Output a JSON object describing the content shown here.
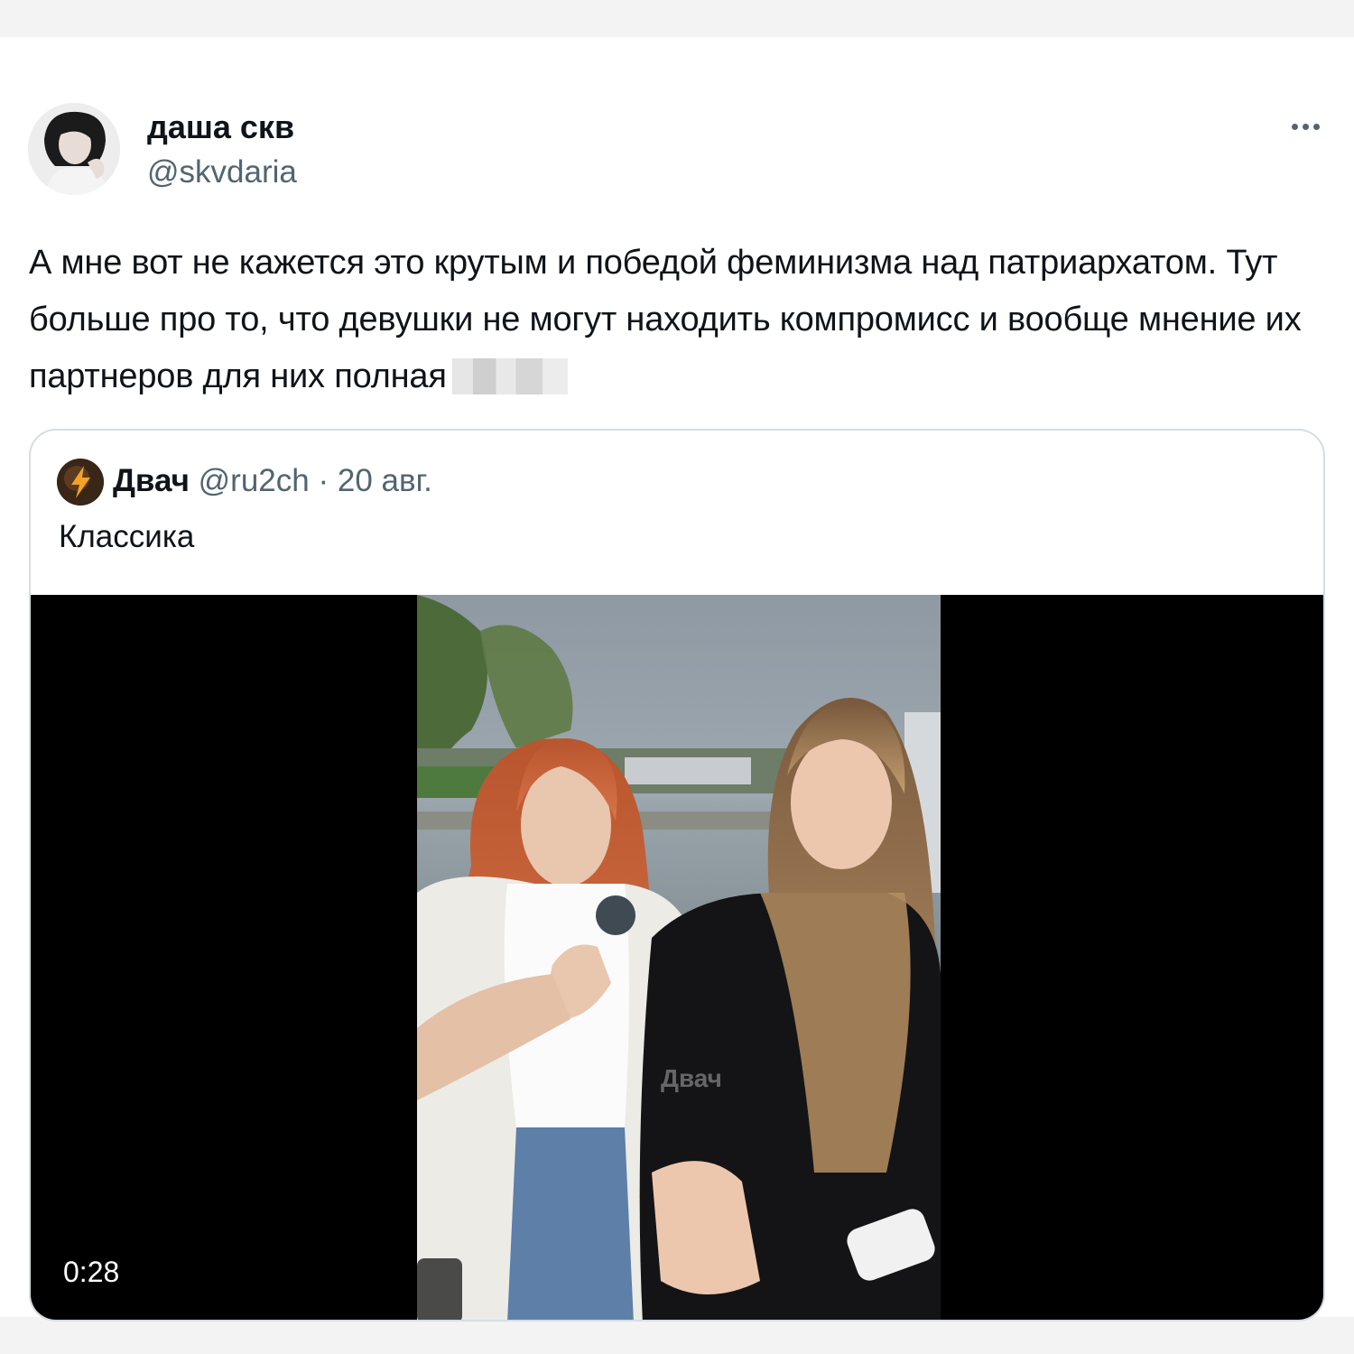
{
  "tweet": {
    "author_name": "даша скв",
    "author_handle": "@skvdaria",
    "more_icon": "more-horizontal-icon",
    "text": "А мне вот не кажется это крутым и победой феминизма над патриархатом. Тут больше про то, что девушки не могут находить компромисс и вообще мнение их партнеров для них полная"
  },
  "quoted_tweet": {
    "author_name": "Двач",
    "author_handle": "@ru2ch",
    "separator": "·",
    "date": "20 авг.",
    "text": "Классика",
    "video": {
      "duration": "0:28",
      "watermark": "Двач"
    }
  },
  "colors": {
    "text_primary": "#0f1419",
    "text_secondary": "#536471",
    "border": "#d7dde2",
    "video_background": "#000000"
  }
}
